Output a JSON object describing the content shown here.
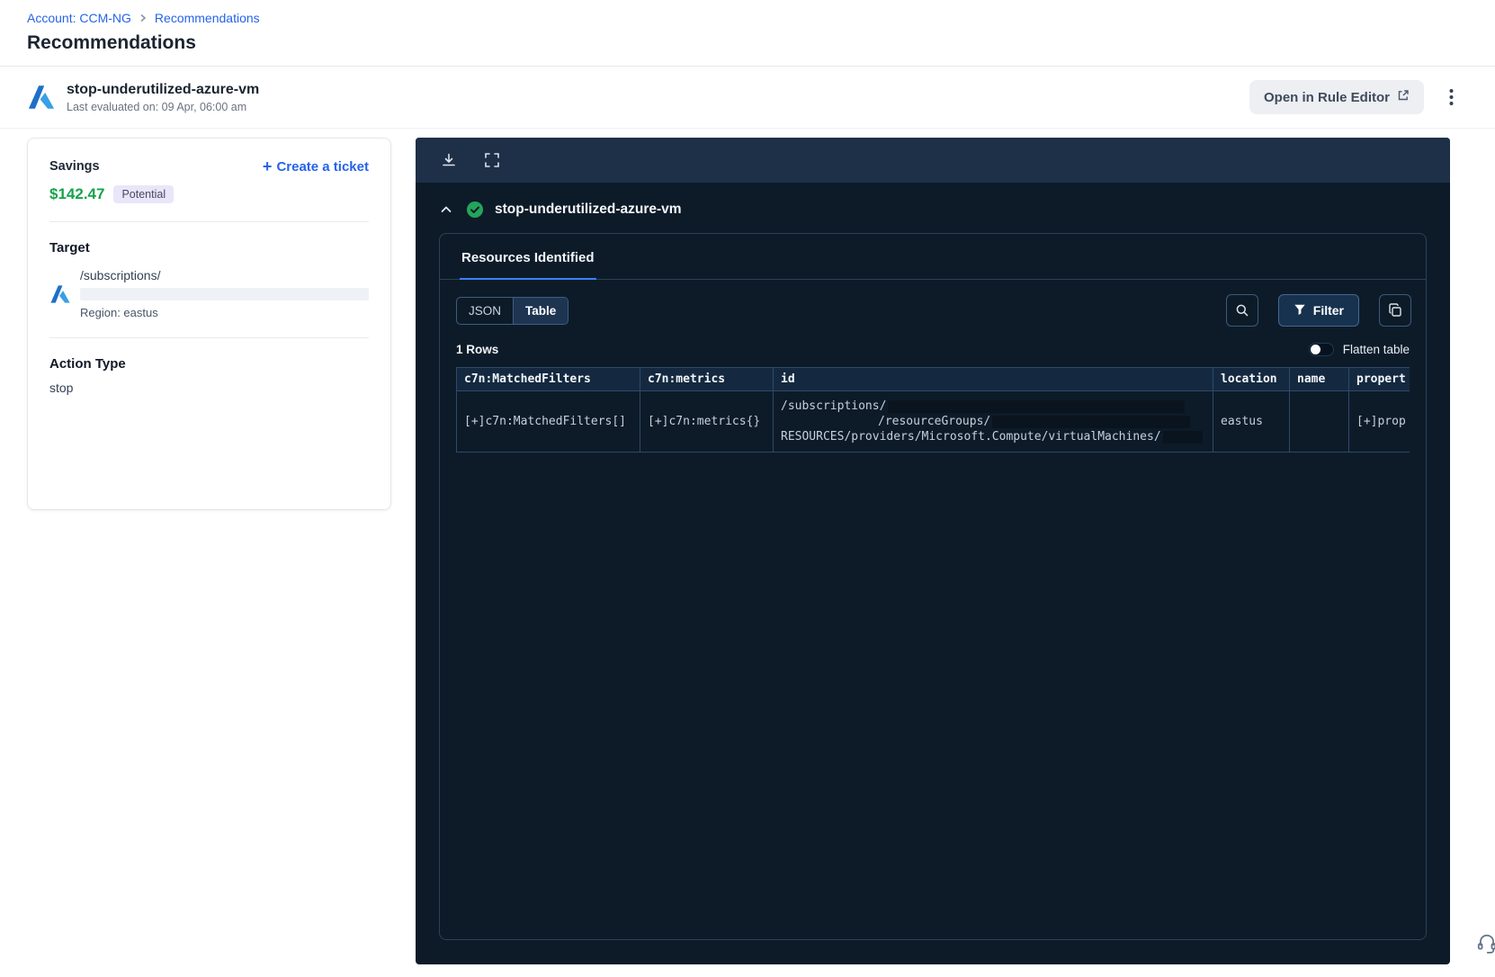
{
  "breadcrumb": {
    "account": "Account: CCM-NG",
    "current": "Recommendations"
  },
  "page": {
    "title": "Recommendations"
  },
  "rule_header": {
    "name": "stop-underutilized-azure-vm",
    "last_evaluated": "Last evaluated on: 09 Apr, 06:00 am",
    "open_in_rule_editor": "Open in Rule Editor"
  },
  "savings": {
    "label": "Savings",
    "amount": "$142.47",
    "badge": "Potential",
    "create_ticket": "Create a ticket"
  },
  "target": {
    "label": "Target",
    "path": "/subscriptions/",
    "region": "Region: eastus"
  },
  "action": {
    "label": "Action Type",
    "value": "stop"
  },
  "viewer": {
    "rule_title": "stop-underutilized-azure-vm",
    "tab": "Resources Identified",
    "segmented": {
      "json": "JSON",
      "table": "Table"
    },
    "filter_label": "Filter",
    "rows_count": "1 Rows",
    "flatten_label": "Flatten table",
    "flatten_state": "off",
    "table": {
      "columns": [
        "c7n:MatchedFilters",
        "c7n:metrics",
        "id",
        "location",
        "name",
        "propert"
      ],
      "row": {
        "matched_filters": "[+]c7n:MatchedFilters[]",
        "metrics": "[+]c7n:metrics{}",
        "id_line1": "/subscriptions/",
        "id_line2": "/resourceGroups/",
        "id_line3": "RESOURCES/providers/Microsoft.Compute/virtualMachines/",
        "location": "eastus",
        "name": "",
        "properties": "[+]prop"
      }
    }
  },
  "icons": {
    "azure": "azure-logo",
    "download": "download-tray",
    "expand": "fullscreen-corners",
    "collapse": "chevron-up",
    "success": "check-circle-green",
    "search": "magnifier",
    "filter": "funnel",
    "copy": "overlapping-squares",
    "kebab": "three-dots-vertical",
    "external": "arrow-out-of-box",
    "chat": "support-headset"
  },
  "colors": {
    "accent_blue": "#2563eb",
    "savings_green": "#16a34a",
    "success_green": "#23a55a",
    "badge_bg": "#e9e6fa",
    "panel_dark": "#0d1b29",
    "toolbar_dark": "#1e3048",
    "table_border": "#2d4a6a",
    "table_header_bg": "#142940"
  }
}
